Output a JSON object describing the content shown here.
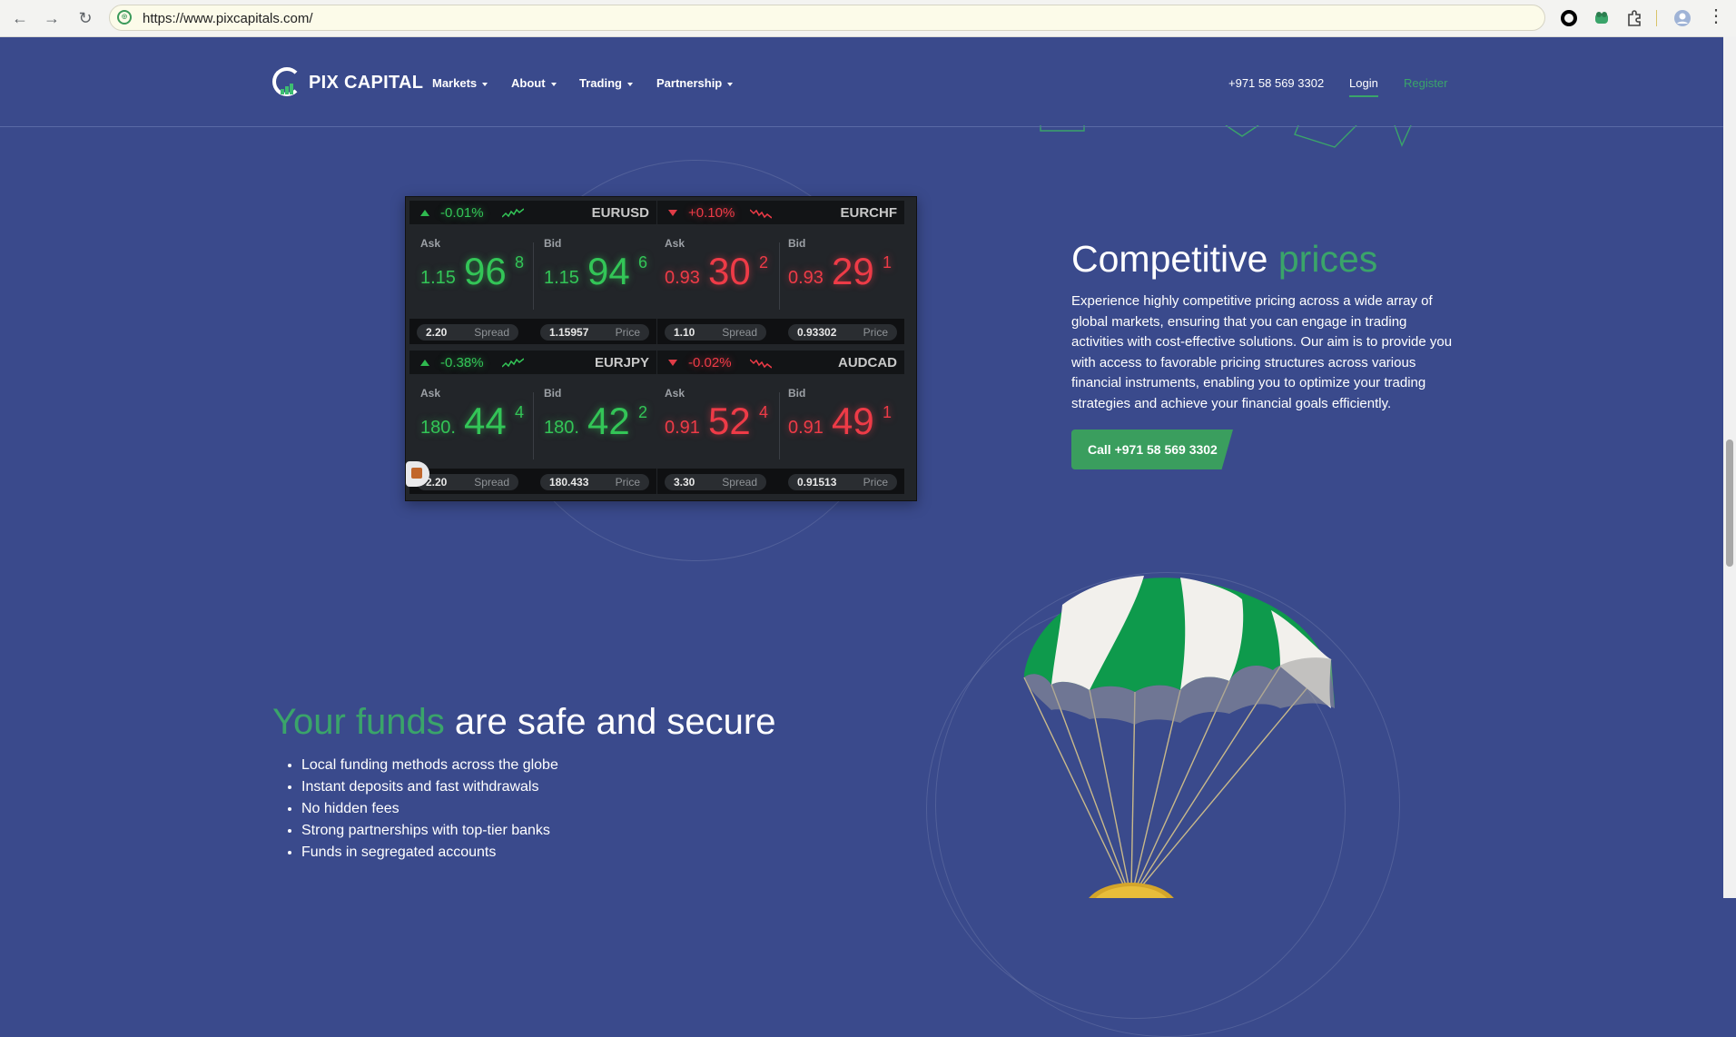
{
  "browser": {
    "url": "https://www.pixcapitals.com/",
    "back_icon": "arrow-left-icon",
    "forward_icon": "arrow-right-icon",
    "reload_icon": "reload-icon"
  },
  "header": {
    "logo_text": "PIX CAPITAL",
    "nav": [
      {
        "label": "Markets"
      },
      {
        "label": "About"
      },
      {
        "label": "Trading"
      },
      {
        "label": "Partnership"
      }
    ],
    "phone": "+971 58 569 3302",
    "login": "Login",
    "register": "Register"
  },
  "colors": {
    "background": "#3a4a8c",
    "accent": "#3aa46a",
    "up": "#33c557",
    "down": "#ee3b47"
  },
  "ticker": [
    {
      "pair": "EURUSD",
      "direction": "up",
      "change": "-0.01%",
      "ask_label": "Ask",
      "ask_pre": "1.15",
      "ask_big": "96",
      "ask_sup": "8",
      "bid_label": "Bid",
      "bid_pre": "1.15",
      "bid_big": "94",
      "bid_sup": "6",
      "spread": "2.20",
      "spread_label": "Spread",
      "price": "1.15957",
      "price_label": "Price"
    },
    {
      "pair": "EURCHF",
      "direction": "down",
      "change": "+0.10%",
      "ask_label": "Ask",
      "ask_pre": "0.93",
      "ask_big": "30",
      "ask_sup": "2",
      "bid_label": "Bid",
      "bid_pre": "0.93",
      "bid_big": "29",
      "bid_sup": "1",
      "spread": "1.10",
      "spread_label": "Spread",
      "price": "0.93302",
      "price_label": "Price"
    },
    {
      "pair": "EURJPY",
      "direction": "up",
      "change": "-0.38%",
      "ask_label": "Ask",
      "ask_pre": "180.",
      "ask_big": "44",
      "ask_sup": "4",
      "bid_label": "Bid",
      "bid_pre": "180.",
      "bid_big": "42",
      "bid_sup": "2",
      "spread": "2.20",
      "spread_label": "Spread",
      "price": "180.433",
      "price_label": "Price"
    },
    {
      "pair": "AUDCAD",
      "direction": "down",
      "change": "-0.02%",
      "ask_label": "Ask",
      "ask_pre": "0.91",
      "ask_big": "52",
      "ask_sup": "4",
      "bid_label": "Bid",
      "bid_pre": "0.91",
      "bid_big": "49",
      "bid_sup": "1",
      "spread": "3.30",
      "spread_label": "Spread",
      "price": "0.91513",
      "price_label": "Price"
    }
  ],
  "prices": {
    "title_main": "Competitive ",
    "title_accent": "prices",
    "body": "Experience highly competitive pricing across a wide array of global markets, ensuring that you can engage in trading activities with cost-effective solutions. Our aim is to provide you with access to favorable pricing structures across various financial instruments, enabling you to optimize your trading strategies and achieve your financial goals efficiently.",
    "button": "Call +971 58 569 3302"
  },
  "funds": {
    "title_accent": "Your funds",
    "title_main": " are safe and secure",
    "items": [
      "Local funding methods across the globe",
      "Instant deposits and fast withdrawals",
      "No hidden fees",
      "Strong partnerships with top-tier banks",
      "Funds in segregated accounts"
    ],
    "illustration_icon": "parachute-icon"
  }
}
